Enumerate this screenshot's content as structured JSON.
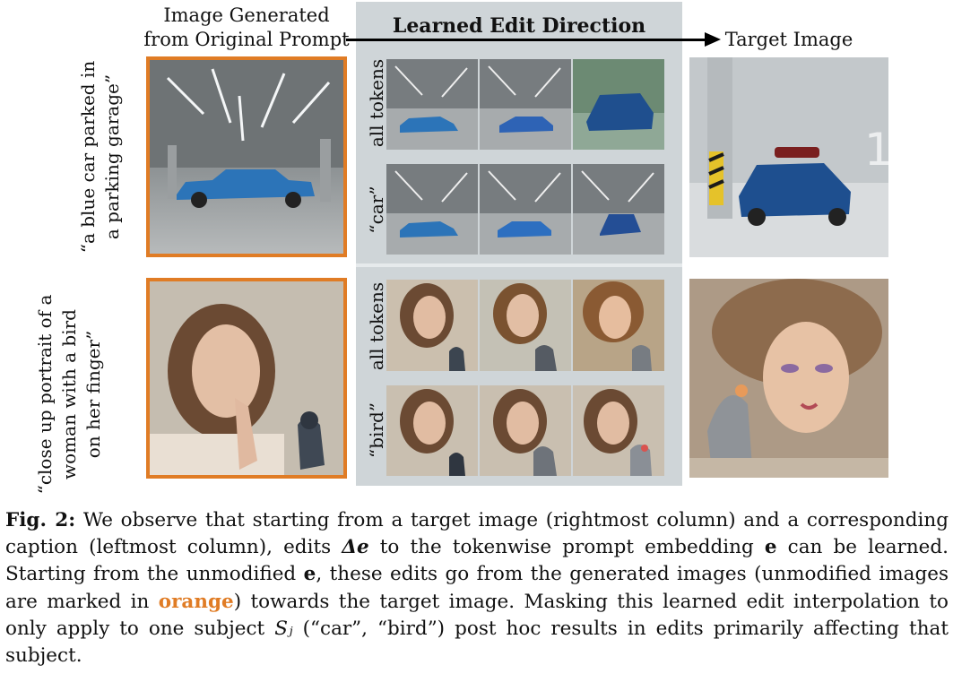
{
  "header": {
    "left_label": "Image Generated\nfrom Original Prompt",
    "middle_label": "Learned Edit Direction",
    "right_label": "Target Image"
  },
  "rows": [
    {
      "prompt": "“a blue car parked in\na parking garage”",
      "edits": [
        {
          "token_label": "all tokens"
        },
        {
          "token_label": "“car”"
        }
      ]
    },
    {
      "prompt": "“close up portrait of a\nwoman with a bird\non her finger”",
      "edits": [
        {
          "token_label": "all tokens"
        },
        {
          "token_label": "“bird”"
        }
      ]
    }
  ],
  "colors": {
    "orange": "#e07c25",
    "panel": "#cfd5d8",
    "car_blue": "#2c74b8"
  },
  "caption": {
    "label": "Fig. 2:",
    "part1": " We observe that starting from a target image (rightmost column) and a corresponding caption (leftmost column), edits ",
    "delta": "Δe",
    "part2": " to the tokenwise prompt embedding ",
    "e1": "e",
    "part3": " can be learned. Starting from the unmodified ",
    "e2": "e",
    "part4": ", these edits go from the generated images (unmodified images are marked in ",
    "orange_word": "orange",
    "part5": ") towards the target image. Masking this learned edit interpolation to only apply to one subject ",
    "subject": "Sⱼ",
    "part6": " (“car”, “bird”) post hoc results in edits primarily affecting that subject."
  }
}
